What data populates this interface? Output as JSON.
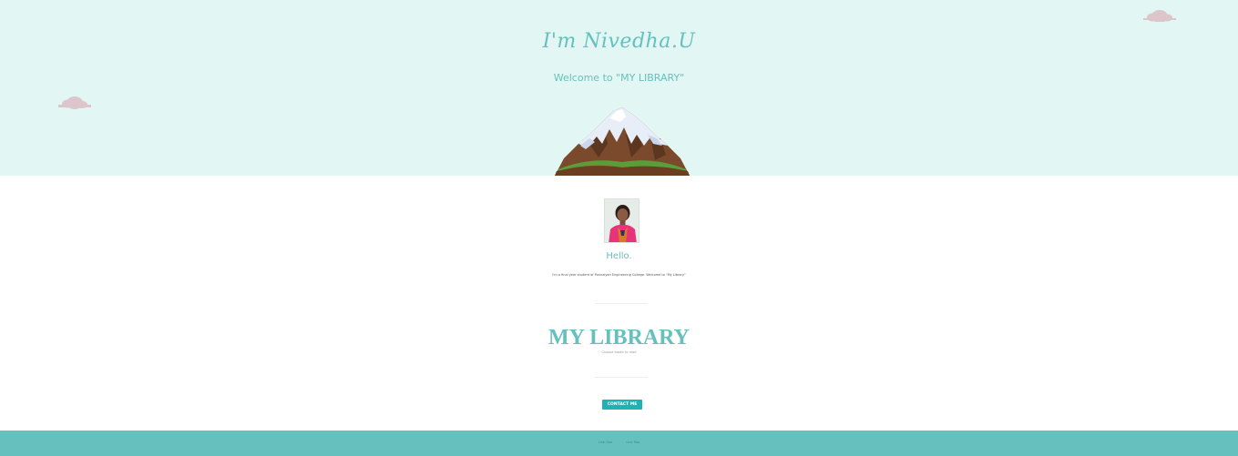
{
  "hero": {
    "title": "I'm Nivedha.U",
    "subtitle": "Welcome to \"MY LIBRARY\""
  },
  "about": {
    "greeting": "Hello.",
    "intro": "I'm a final year student of Ponnaiyan Engineering College. Welcome to \"My Library\""
  },
  "library": {
    "title": "MY LIBRARY",
    "subtitle": "Choose books to read"
  },
  "contact_button_label": "CONTACT ME",
  "footer": {
    "links": [
      "Link One",
      "Link Two"
    ]
  },
  "colors": {
    "accent": "#66c0be",
    "hero_background": "#e2f7f4",
    "button": "#1db3b3",
    "footer": "#66c0be",
    "cloud": "#dcc6cb"
  },
  "icons": [
    "cloud-icon",
    "mountain-illustration"
  ]
}
